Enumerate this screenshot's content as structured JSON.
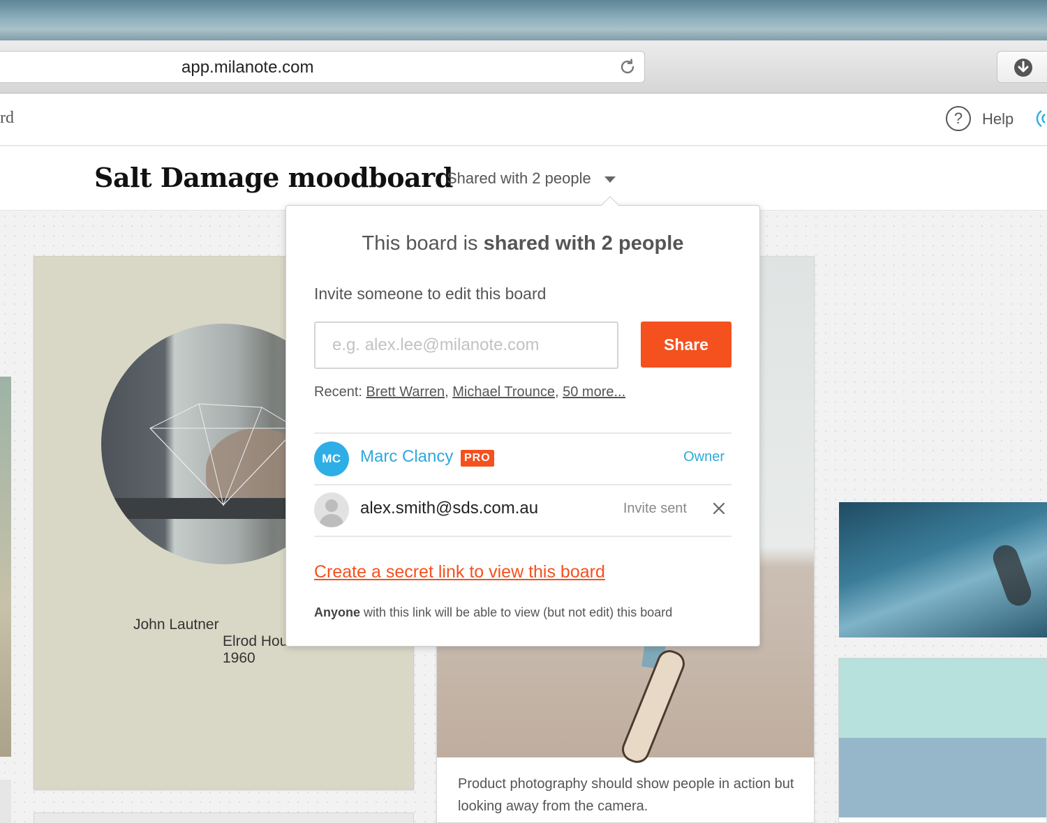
{
  "browser": {
    "url": "app.milanote.com"
  },
  "header": {
    "breadcrumb_tail": "rd",
    "help_label": "Help"
  },
  "board": {
    "title": "Salt Damage moodboard",
    "share_summary": "Shared with 2 people"
  },
  "popover": {
    "heading_prefix": "This board is ",
    "heading_bold": "shared with 2 people",
    "invite_label": "Invite someone to edit this board",
    "email_placeholder": "e.g. alex.lee@milanote.com",
    "email_value": "",
    "share_button": "Share",
    "recent_label": "Recent:",
    "recent_links": [
      "Brett Warren",
      "Michael Trounce",
      "50 more..."
    ],
    "members": [
      {
        "initials": "MC",
        "name": "Marc Clancy",
        "badge": "PRO",
        "role": "Owner",
        "avatar_color": "#2eaee6"
      },
      {
        "name": "alex.smith@sds.com.au",
        "status": "Invite sent"
      }
    ],
    "secret_link_label": "Create a secret link to view this board",
    "link_note_bold": "Anyone",
    "link_note_rest": " with this link will be able to view (but not edit) this board"
  },
  "cards": {
    "poster_line_1": "John Lautner",
    "poster_line_2": "Elrod Hou",
    "poster_line_3": "1960",
    "photo_caption": "Product photography should show people in action but looking away from the camera."
  },
  "colors": {
    "accent_orange": "#f4511e",
    "accent_blue": "#2ea9dd"
  }
}
